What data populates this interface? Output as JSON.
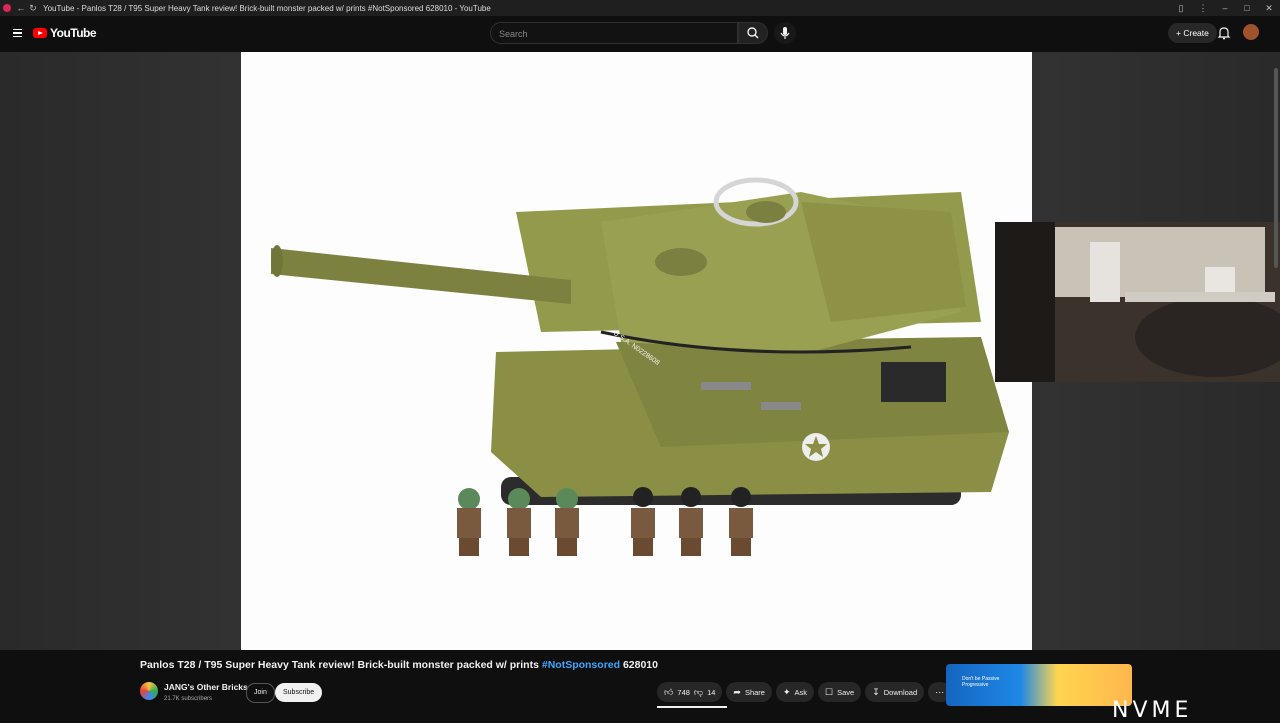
{
  "window": {
    "title": "YouTube - Panlos T28 / T95 Super Heavy Tank review! Brick-built monster packed w/ prints #NotSponsored 628010 - YouTube"
  },
  "header": {
    "logo_text": "YouTube",
    "search_placeholder": "Search",
    "create_label": "Create"
  },
  "video": {
    "title_main": "Panlos T28 / T95 Super Heavy Tank review! Brick-built monster packed w/ prints",
    "hashtag": "#NotSponsored",
    "title_suffix": "628010",
    "tank_marking": "U.S.A. N0228608"
  },
  "channel": {
    "name": "JANG's Other Bricks",
    "subscribers": "21.7K subscribers",
    "join_label": "Join",
    "subscribe_label": "Subscribe"
  },
  "actions": {
    "likes": "748",
    "dislikes": "14",
    "share": "Share",
    "ask": "Ask",
    "save": "Save",
    "download": "Download"
  },
  "ad": {
    "text": "Don't be Passive Progressive"
  },
  "watermark": "NVME",
  "colors": {
    "background": "#0f0f0f",
    "brand_red": "#ff0000",
    "link_blue": "#3ea6ff",
    "tank_olive": "#8a8f45"
  },
  "icons": [
    "menu-icon",
    "search-icon",
    "mic-icon",
    "plus-icon",
    "bell-icon",
    "like-icon",
    "dislike-icon",
    "share-icon",
    "ask-icon",
    "save-icon",
    "download-icon",
    "more-icon"
  ]
}
